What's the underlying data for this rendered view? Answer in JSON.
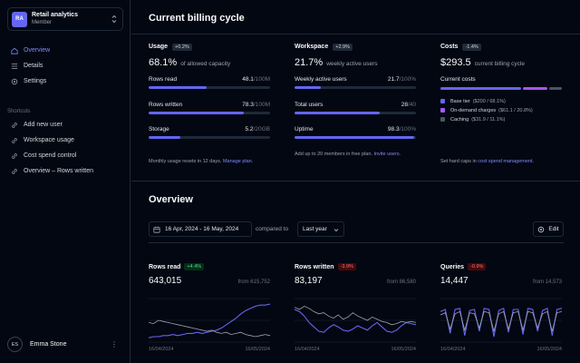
{
  "workspace": {
    "initials": "RA",
    "name": "Retail analytics",
    "role": "Member"
  },
  "nav": [
    {
      "label": "Overview",
      "icon": "home-icon",
      "active": true
    },
    {
      "label": "Details",
      "icon": "list-icon",
      "active": false
    },
    {
      "label": "Settings",
      "icon": "gear-icon",
      "active": false
    }
  ],
  "shortcuts": {
    "title": "Shortcuts",
    "items": [
      {
        "label": "Add new user",
        "icon": "link-icon"
      },
      {
        "label": "Workspace usage",
        "icon": "link-icon"
      },
      {
        "label": "Cost spend control",
        "icon": "link-icon"
      },
      {
        "label": "Overview – Rows written",
        "icon": "link-icon"
      }
    ]
  },
  "user": {
    "initials": "ES",
    "name": "Emma Stone",
    "menu": "⋮"
  },
  "billing": {
    "title": "Current billing cycle",
    "usage": {
      "title": "Usage",
      "badge": "+0.2%",
      "value": "68.1%",
      "value_sub": "of allowed capacity",
      "metrics": [
        {
          "label": "Rows read",
          "value": "48.1",
          "max": "/100M",
          "percent": 48.1
        },
        {
          "label": "Rows written",
          "value": "78.3",
          "max": "/100M",
          "percent": 78.3
        },
        {
          "label": "Storage",
          "value": "5.2",
          "max": "/20GB",
          "percent": 26
        }
      ],
      "footer": "Monthly usage resets in 12 days.",
      "footer_link": "Manage plan."
    },
    "workspace": {
      "title": "Workspace",
      "badge": "+2.9%",
      "value": "21.7%",
      "value_sub": "weekly active users",
      "metrics": [
        {
          "label": "Weekly active users",
          "value": "21.7",
          "max": "/100%",
          "percent": 21.7
        },
        {
          "label": "Total users",
          "value": "28",
          "max": "/40",
          "percent": 70
        },
        {
          "label": "Uptime",
          "value": "98.3",
          "max": "/100%",
          "percent": 98.3
        }
      ],
      "footer": "Add up to 20 members in free plan.",
      "footer_link": "Invite users."
    },
    "costs": {
      "title": "Costs",
      "badge": "-1.4%",
      "value": "$293.5",
      "value_sub": "current billing cycle",
      "breakdown_title": "Current costs",
      "items": [
        {
          "label": "Base tier",
          "detail": "($200 / 68.1%)",
          "color": "#6366f1",
          "percent": 68.1
        },
        {
          "label": "On-demand charges",
          "detail": "($61.1 / 20.8%)",
          "color": "#a855f7",
          "percent": 20.8
        },
        {
          "label": "Caching",
          "detail": "($31.9 / 11.1%)",
          "color": "#4b5563",
          "percent": 11.1
        }
      ],
      "footer": "Set hard caps in",
      "footer_link": "cost spend management."
    }
  },
  "overview": {
    "title": "Overview",
    "date_range": "16 Apr, 2024 - 16 May, 2024",
    "compared_label": "compared to",
    "compare_value": "Last year",
    "edit_label": "Edit"
  },
  "chart_data": [
    {
      "type": "line",
      "title": "Rows read",
      "badge": "+4.4%",
      "value": "643,015",
      "from": "from 615,752",
      "x_start": "16/04/2024",
      "x_end": "16/05/2024",
      "series": [
        {
          "values": [
            4,
            5,
            5,
            6,
            6,
            7,
            6,
            7,
            8,
            8,
            9,
            8,
            9,
            10,
            11,
            13,
            16,
            19,
            22,
            26,
            29,
            31,
            33,
            34,
            34,
            35
          ]
        },
        {
          "values": [
            18,
            17,
            20,
            19,
            18,
            17,
            16,
            15,
            14,
            13,
            12,
            11,
            10,
            11,
            9,
            8,
            9,
            7,
            8,
            9,
            7,
            6,
            5,
            6,
            7,
            6
          ]
        }
      ],
      "ylim": [
        0,
        40
      ]
    },
    {
      "type": "line",
      "title": "Rows written",
      "badge": "-3.9%",
      "value": "83,197",
      "from": "from 86,580",
      "x_start": "16/04/2024",
      "x_end": "16/05/2024",
      "series": [
        {
          "values": [
            30,
            28,
            24,
            18,
            14,
            10,
            9,
            13,
            16,
            14,
            11,
            10,
            12,
            15,
            13,
            11,
            15,
            18,
            14,
            10,
            9,
            11,
            15,
            18,
            17,
            16
          ]
        },
        {
          "values": [
            32,
            30,
            33,
            31,
            28,
            26,
            27,
            24,
            22,
            25,
            21,
            23,
            27,
            24,
            22,
            20,
            23,
            21,
            19,
            18,
            16,
            17,
            19,
            18,
            19,
            18
          ]
        }
      ],
      "ylim": [
        0,
        40
      ]
    },
    {
      "type": "line",
      "title": "Queries",
      "badge": "-0.9%",
      "value": "14,447",
      "from": "from 14,573",
      "x_start": "16/04/2024",
      "x_end": "16/05/2024",
      "series": [
        {
          "values": [
            28,
            30,
            8,
            30,
            31,
            6,
            29,
            30,
            10,
            31,
            30,
            5,
            29,
            31,
            9,
            30,
            30,
            7,
            31,
            30,
            10,
            29,
            31,
            6,
            30,
            31
          ]
        },
        {
          "values": [
            25,
            27,
            12,
            26,
            28,
            11,
            27,
            26,
            13,
            28,
            27,
            10,
            26,
            28,
            12,
            27,
            28,
            11,
            28,
            27,
            13,
            26,
            28,
            10,
            27,
            28
          ]
        }
      ],
      "ylim": [
        0,
        40
      ]
    }
  ],
  "colors": {
    "accent": "#6366f1",
    "secondary_line": "#9ca3af"
  }
}
